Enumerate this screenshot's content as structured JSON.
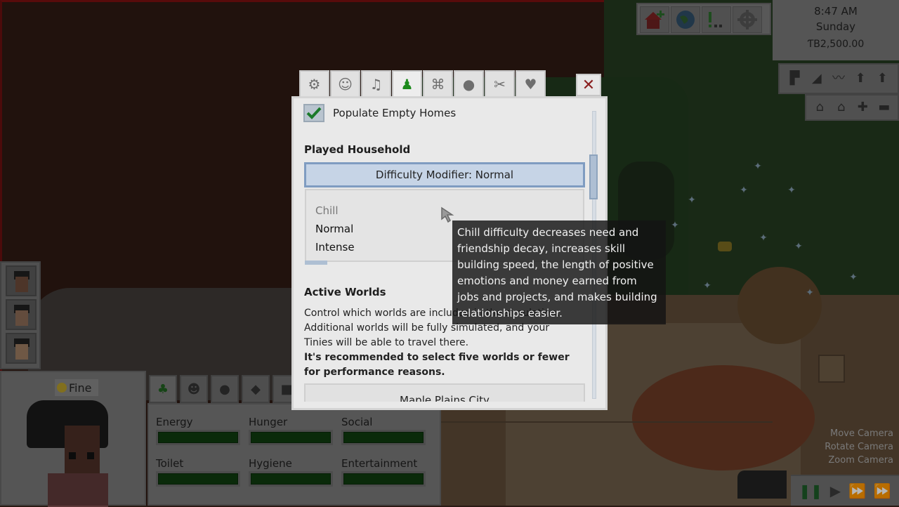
{
  "hud": {
    "time": "8:47 AM",
    "day": "Sunday",
    "money": "ƬB2,500.00"
  },
  "sim": {
    "mood": "Fine"
  },
  "needs": [
    {
      "label": "Energy"
    },
    {
      "label": "Hunger"
    },
    {
      "label": "Social"
    },
    {
      "label": "Toilet"
    },
    {
      "label": "Hygiene"
    },
    {
      "label": "Entertainment"
    }
  ],
  "camera_hints": {
    "move": "Move Camera",
    "rotate": "Rotate Camera",
    "zoom": "Zoom Camera"
  },
  "settings": {
    "populate_label": "Populate Empty Homes",
    "played_household_title": "Played Household",
    "difficulty_button": "Difficulty Modifier: Normal",
    "difficulty_options": [
      "Chill",
      "Normal",
      "Intense"
    ],
    "active_worlds_title": "Active Worlds",
    "worlds_desc_line1": "Control which worlds are included in the simulation.",
    "worlds_desc_line2": "Additional worlds will be fully simulated, and your",
    "worlds_desc_line3": "Tinies will be able to travel there.",
    "worlds_warning": "It's recommended to select five worlds or fewer for performance reasons.",
    "world_item": "Maple Plains City",
    "close_label": "✕"
  },
  "tooltip": {
    "text": "Chill difficulty decreases need and friendship decay, increases skill building speed, the length of positive emotions and money earned from jobs and projects, and makes building relationships easier."
  },
  "colors": {
    "accent_blue": "#7f9cc1",
    "need_bar_green": "#0f3b0f",
    "active_tab_green": "#1c8a1c"
  }
}
